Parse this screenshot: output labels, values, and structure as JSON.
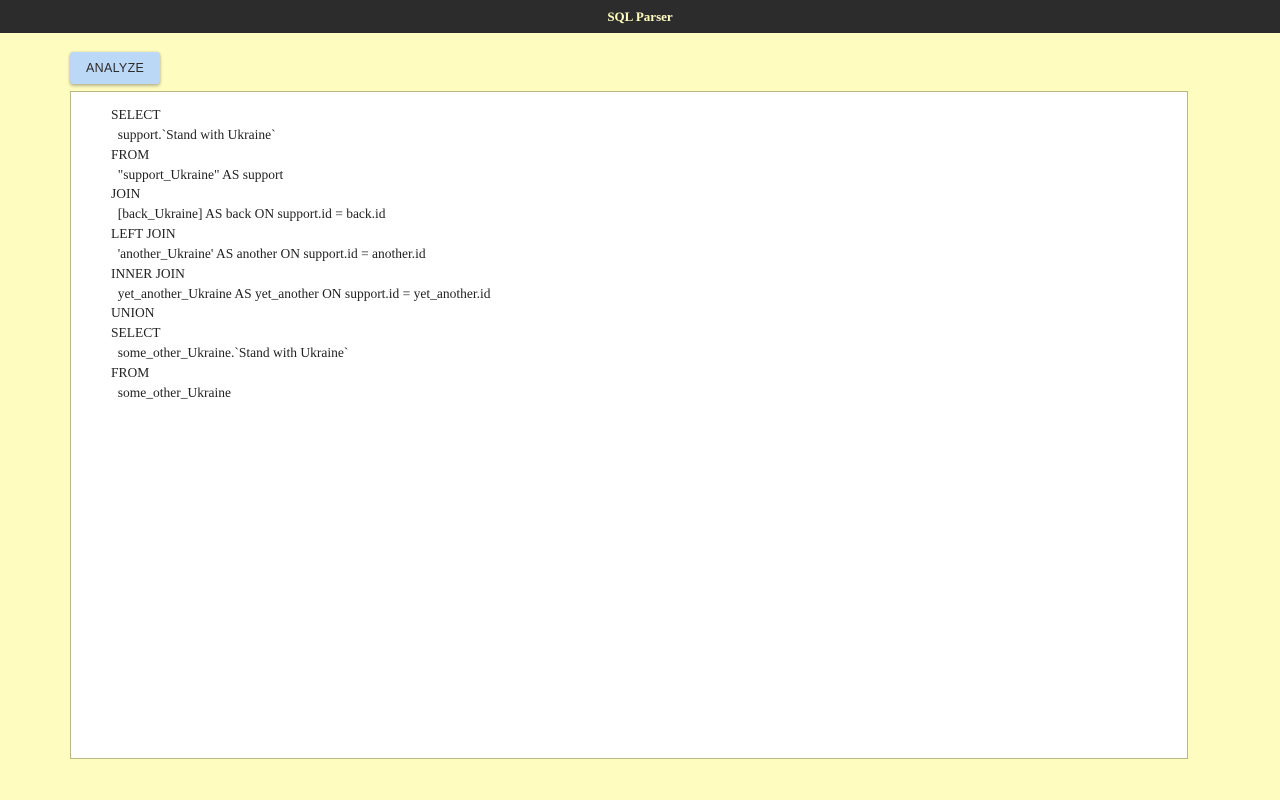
{
  "header": {
    "title": "SQL Parser"
  },
  "controls": {
    "analyze_label": "ANALYZE"
  },
  "editor": {
    "sql": "SELECT\n  support.`Stand with Ukraine`\nFROM\n  \"support_Ukraine\" AS support\nJOIN\n  [back_Ukraine] AS back ON support.id = back.id\nLEFT JOIN\n  'another_Ukraine' AS another ON support.id = another.id\nINNER JOIN\n  yet_another_Ukraine AS yet_another ON support.id = yet_another.id\nUNION\nSELECT\n  some_other_Ukraine.`Stand with Ukraine`\nFROM\n  some_other_Ukraine"
  }
}
